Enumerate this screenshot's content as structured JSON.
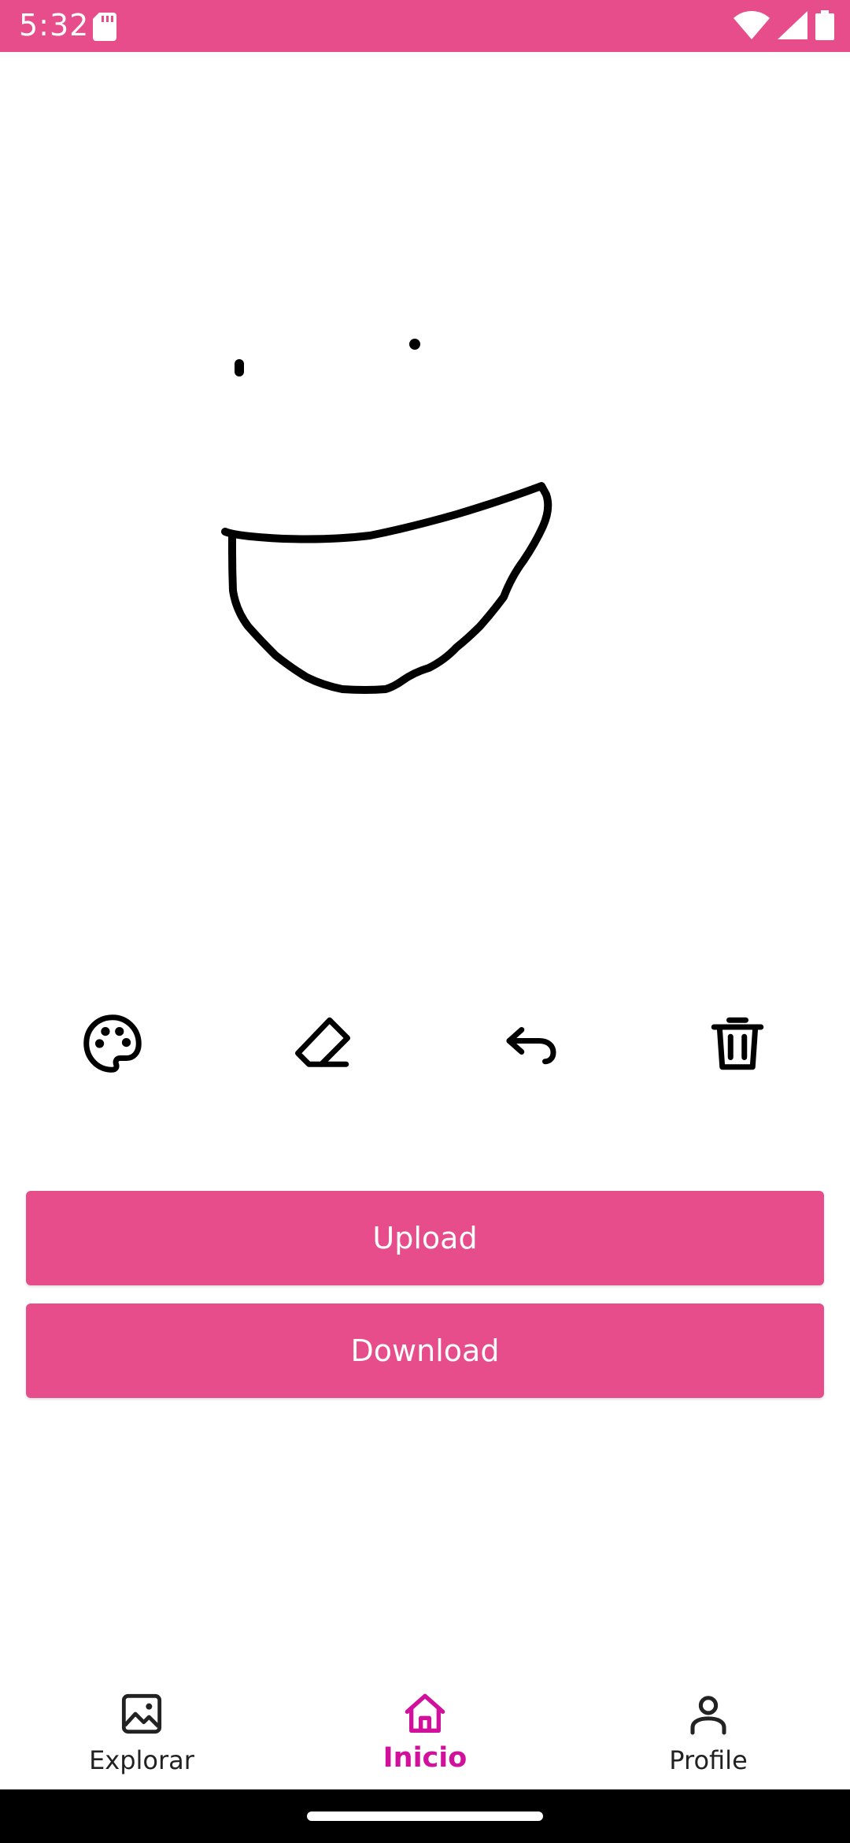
{
  "status_bar": {
    "time": "5:32",
    "background": "#E64D8A"
  },
  "tools": [
    {
      "name": "palette",
      "icon": "palette-icon"
    },
    {
      "name": "eraser",
      "icon": "eraser-icon"
    },
    {
      "name": "undo",
      "icon": "undo-icon"
    },
    {
      "name": "clear",
      "icon": "trash-icon"
    }
  ],
  "actions": {
    "upload_label": "Upload",
    "download_label": "Download",
    "button_color": "#E64D8A"
  },
  "bottom_nav": {
    "items": [
      {
        "label": "Explorar",
        "icon": "image-icon",
        "active": false
      },
      {
        "label": "Inicio",
        "icon": "home-icon",
        "active": true
      },
      {
        "label": "Profile",
        "icon": "person-icon",
        "active": false
      }
    ],
    "active_color": "#D1109B"
  }
}
